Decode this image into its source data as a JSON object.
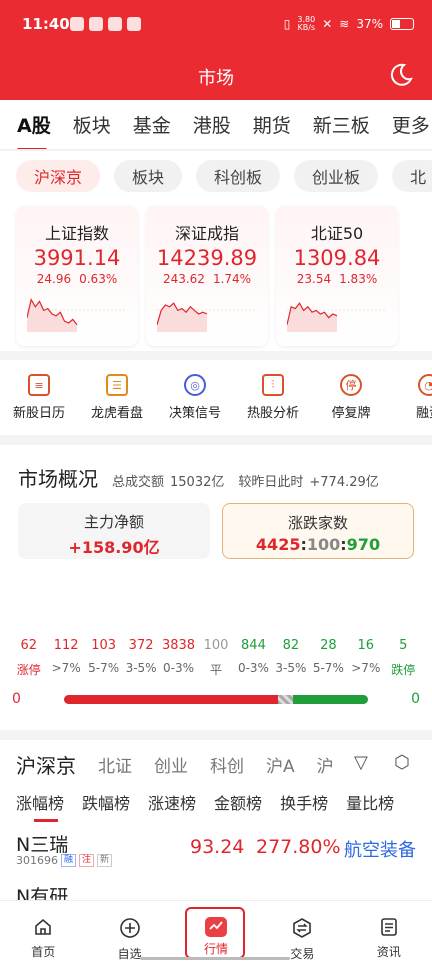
{
  "status_bar": {
    "time": "11:40",
    "net_speed_value": "3.80",
    "net_speed_unit": "KB/s",
    "battery": "37%"
  },
  "header": {
    "title": "市场"
  },
  "top_tabs": [
    "A股",
    "板块",
    "基金",
    "港股",
    "期货",
    "新三板",
    "更多"
  ],
  "sub_tabs": [
    "沪深京",
    "板块",
    "科创板",
    "创业板",
    "北"
  ],
  "indices": [
    {
      "name": "上证指数",
      "price": "3991.14",
      "change": "24.96",
      "pct": "0.63%",
      "trend": [
        0.4,
        0.9,
        0.7,
        0.85,
        0.6,
        0.65,
        0.5,
        0.45,
        0.55,
        0.3,
        0.25,
        0.35,
        0.2
      ]
    },
    {
      "name": "深证成指",
      "price": "14239.89",
      "change": "243.62",
      "pct": "1.74%",
      "trend": [
        0.2,
        0.6,
        0.75,
        0.7,
        0.8,
        0.6,
        0.65,
        0.55,
        0.7,
        0.6,
        0.5,
        0.55,
        0.5
      ]
    },
    {
      "name": "北证50",
      "price": "1309.84",
      "change": "23.54",
      "pct": "1.83%",
      "trend": [
        0.2,
        0.7,
        0.65,
        0.8,
        0.6,
        0.7,
        0.55,
        0.6,
        0.5,
        0.55,
        0.4,
        0.5,
        0.45
      ]
    }
  ],
  "quick_tools": [
    {
      "label": "新股日历",
      "icon": "document-icon",
      "glyph": "≡"
    },
    {
      "label": "龙虎看盘",
      "icon": "clipboard-icon",
      "glyph": "☰"
    },
    {
      "label": "决策信号",
      "icon": "radar-icon",
      "glyph": "◎"
    },
    {
      "label": "热股分析",
      "icon": "candlestick-icon",
      "glyph": "⫶"
    },
    {
      "label": "停复牌",
      "icon": "stop-icon",
      "glyph": "停"
    },
    {
      "label": "融资",
      "icon": "finance-icon",
      "glyph": "◔"
    }
  ],
  "overview": {
    "title": "市场概况",
    "turnover_label": "总成交额",
    "turnover_value": "15032亿",
    "compare_label": "较昨日此时",
    "compare_value": "+774.29亿",
    "net_inflow_label": "主力净额",
    "net_inflow_value": "+158.90亿",
    "updown_label": "涨跌家数",
    "up_count": "4425",
    "sep1": ":",
    "flat_count": "100",
    "sep2": ":",
    "down_count": "970",
    "distribution": [
      {
        "count": "62",
        "label": "涨停",
        "color": "red"
      },
      {
        "count": "112",
        "label": ">7%",
        "color": "red"
      },
      {
        "count": "103",
        "label": "5-7%",
        "color": "red"
      },
      {
        "count": "372",
        "label": "3-5%",
        "color": "red"
      },
      {
        "count": "3838",
        "label": "0-3%",
        "color": "red"
      },
      {
        "count": "100",
        "label": "平",
        "color": "grey"
      },
      {
        "count": "844",
        "label": "0-3%",
        "color": "green"
      },
      {
        "count": "82",
        "label": "3-5%",
        "color": "green"
      },
      {
        "count": "28",
        "label": "5-7%",
        "color": "green"
      },
      {
        "count": "16",
        "label": ">7%",
        "color": "green"
      },
      {
        "count": "5",
        "label": "跌停",
        "color": "green"
      }
    ],
    "limit_up_left": "0",
    "limit_down_right": "0",
    "bar_ratio": {
      "up": 4425,
      "flat": 100,
      "down": 970
    }
  },
  "market_tabs": [
    "沪深京",
    "北证",
    "创业",
    "科创",
    "沪A",
    "沪"
  ],
  "rank_tabs": [
    "涨幅榜",
    "跌幅榜",
    "涨速榜",
    "金额榜",
    "换手榜",
    "量比榜"
  ],
  "stocks": [
    {
      "name": "N三瑞",
      "code": "301696",
      "badges": [
        "融",
        "注",
        "新"
      ],
      "price": "93.24",
      "pct": "277.80%",
      "industry": "航空装备"
    },
    {
      "name": "N有研",
      "code": "",
      "badges": [],
      "price": "",
      "pct": "",
      "industry": ""
    }
  ],
  "bottom_nav": [
    {
      "label": "首页",
      "icon": "home-icon"
    },
    {
      "label": "自选",
      "icon": "add-circle-icon"
    },
    {
      "label": "行情",
      "icon": "chart-icon"
    },
    {
      "label": "交易",
      "icon": "exchange-icon"
    },
    {
      "label": "资讯",
      "icon": "news-icon"
    }
  ],
  "colors": {
    "brand_red": "#ea2b31",
    "up_red": "#e0262d",
    "down_green": "#1f9e3a",
    "link_blue": "#2f6ae0"
  }
}
